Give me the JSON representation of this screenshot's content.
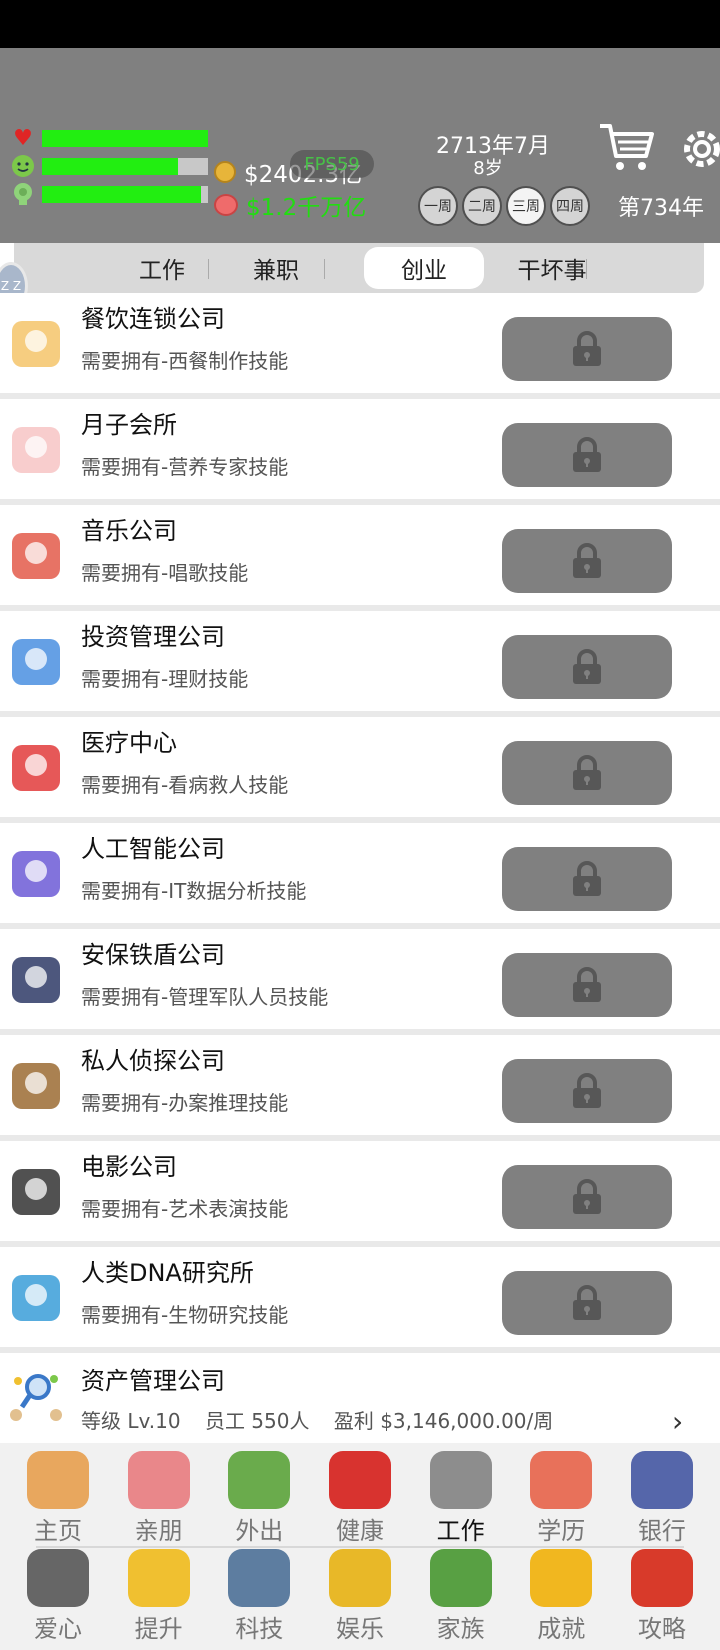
{
  "status": {
    "health": 1.0,
    "happiness": 0.82,
    "smarts": 0.96,
    "cash": "$2402.3亿",
    "savings": "$1.2千万亿",
    "fps": "FPS59",
    "date": "2713年7月",
    "age": "8岁",
    "weeks": [
      "一周",
      "二周",
      "三周",
      "四周"
    ],
    "active_week": 2,
    "year_count": "第734年",
    "side_badge": "Z Z"
  },
  "tabs": [
    {
      "label": "工作",
      "active": false
    },
    {
      "label": "兼职",
      "active": false
    },
    {
      "label": "创业",
      "active": true
    },
    {
      "label": "干坏事",
      "active": false
    }
  ],
  "companies": [
    {
      "title": "餐饮连锁公司",
      "requirement": "需要拥有-西餐制作技能",
      "icon": "restaurant-building-icon",
      "color": "#f4c46a"
    },
    {
      "title": "月子会所",
      "requirement": "需要拥有-营养专家技能",
      "icon": "mother-baby-icon",
      "color": "#f7c4c4"
    },
    {
      "title": "音乐公司",
      "requirement": "需要拥有-唱歌技能",
      "icon": "singer-girl-icon",
      "color": "#e35a4a"
    },
    {
      "title": "投资管理公司",
      "requirement": "需要拥有-理财技能",
      "icon": "investment-chart-icon",
      "color": "#4a8fe0"
    },
    {
      "title": "医疗中心",
      "requirement": "需要拥有-看病救人技能",
      "icon": "heart-hands-icon",
      "color": "#e23b3b"
    },
    {
      "title": "人工智能公司",
      "requirement": "需要拥有-IT数据分析技能",
      "icon": "robot-icon",
      "color": "#6c5bd6"
    },
    {
      "title": "安保铁盾公司",
      "requirement": "需要拥有-管理军队人员技能",
      "icon": "security-guard-icon",
      "color": "#2e3a66"
    },
    {
      "title": "私人侦探公司",
      "requirement": "需要拥有-办案推理技能",
      "icon": "detective-icon",
      "color": "#9b6b33"
    },
    {
      "title": "电影公司",
      "requirement": "需要拥有-艺术表演技能",
      "icon": "clapperboard-icon",
      "color": "#333333"
    },
    {
      "title": "人类DNA研究所",
      "requirement": "需要拥有-生物研究技能",
      "icon": "dna-research-icon",
      "color": "#3a9ed8"
    }
  ],
  "asset": {
    "title": "资产管理公司",
    "level": "等级 Lv.10",
    "staff": "员工 550人",
    "profit": "盈利 $3,146,000.00/周",
    "icon": "asset-management-icon"
  },
  "nav_row1": [
    {
      "label": "主页",
      "icon": "home-icon",
      "color": "#e8a75e"
    },
    {
      "label": "亲朋",
      "icon": "handshake-icon",
      "color": "#e9878a"
    },
    {
      "label": "外出",
      "icon": "tent-icon",
      "color": "#6aab4c"
    },
    {
      "label": "健康",
      "icon": "red-cross-icon",
      "color": "#d8332f"
    },
    {
      "label": "工作",
      "icon": "worker-icon",
      "color": "#8d8d8d",
      "active": true
    },
    {
      "label": "学历",
      "icon": "student-icon",
      "color": "#e8715a"
    },
    {
      "label": "银行",
      "icon": "bank-icon",
      "color": "#5566aa"
    }
  ],
  "nav_row2": [
    {
      "label": "爱心",
      "icon": "dog-icon",
      "color": "#666666"
    },
    {
      "label": "提升",
      "icon": "lightbulb-icon",
      "color": "#f0c030"
    },
    {
      "label": "科技",
      "icon": "scientist-icon",
      "color": "#5d7da0"
    },
    {
      "label": "娱乐",
      "icon": "trophy-cup-icon",
      "color": "#e8b828"
    },
    {
      "label": "家族",
      "icon": "family-tree-icon",
      "color": "#58a043"
    },
    {
      "label": "成就",
      "icon": "gold-trophy-icon",
      "color": "#f1b71f"
    },
    {
      "label": "攻略",
      "icon": "tips-icon",
      "color": "#d83a2a"
    }
  ]
}
